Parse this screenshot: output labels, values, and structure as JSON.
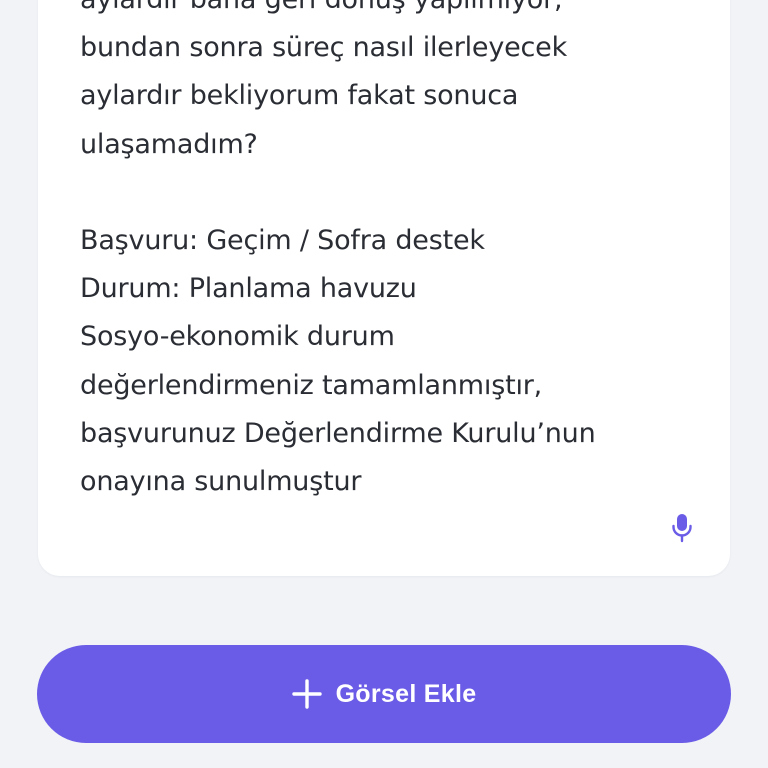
{
  "message_card": {
    "text": "aylardır bana geri dönüş yapılmıyor,\nbundan sonra süreç nasıl ilerleyecek\naylardır bekliyorum fakat sonuca\nulaşamadım?\n\nBaşvuru: Geçim / Sofra destek\nDurum: Planlama havuzu\nSosyo-ekonomik durum\ndeğerlendirmeniz tamamlanmıştır,\nbaşvurunuz Değerlendirme Kurulu’nun\nonayına sunulmuştur",
    "mic_icon": "microphone-icon"
  },
  "add_image_button": {
    "icon": "plus-icon",
    "label": "Görsel Ekle"
  },
  "colors": {
    "background": "#f1f3f7",
    "card": "#ffffff",
    "text": "#2a2d34",
    "accent": "#6b5ce7",
    "mic": "#6b5ce7"
  }
}
